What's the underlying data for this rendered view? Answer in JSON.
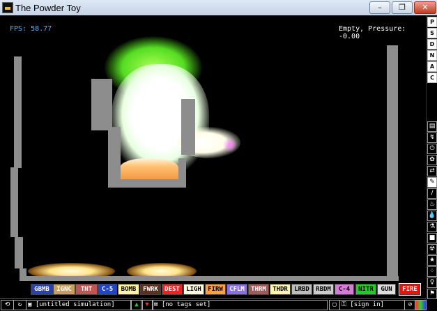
{
  "window": {
    "title": "The Powder Toy",
    "buttons": [
      "–",
      "❐",
      "✕"
    ]
  },
  "hud": {
    "fps": "FPS: 58.77",
    "pressure": "Empty, Pressure: -0.00"
  },
  "menu_buttons": [
    "P",
    "S",
    "D",
    "N",
    "A",
    "C"
  ],
  "tool_icons": [
    "settings-icon",
    "plug-icon",
    "power-icon",
    "gear-icon",
    "arrows-icon",
    "pencil-icon",
    "slash-icon",
    "flame-icon",
    "drop-icon",
    "flask-icon",
    "square-icon",
    "radiation-icon",
    "star-icon",
    "dots-icon",
    "bulb-icon",
    "flag-icon"
  ],
  "tool_glyphs": [
    "▤",
    "↯",
    "⏻",
    "✿",
    "⇄",
    "✎",
    "/",
    "♨",
    "💧",
    "⚗",
    "■",
    "☢",
    "★",
    "⁘",
    "♀",
    "⚑"
  ],
  "elements": [
    {
      "label": "GBMB",
      "bg": "#2b3fae",
      "fg": "#ffffff"
    },
    {
      "label": "IGNC",
      "bg": "#c8a05c",
      "fg": "#ffffff"
    },
    {
      "label": "TNT",
      "bg": "#c05555",
      "fg": "#ffffff"
    },
    {
      "label": "C-5",
      "bg": "#2244cc",
      "fg": "#ffffff"
    },
    {
      "label": "BOMB",
      "bg": "#fff5a0",
      "fg": "#000000"
    },
    {
      "label": "FWRK",
      "bg": "#5a3020",
      "fg": "#ffffff"
    },
    {
      "label": "DEST",
      "bg": "#ee2222",
      "fg": "#ffffff"
    },
    {
      "label": "LIGH",
      "bg": "#fffbe0",
      "fg": "#000000"
    },
    {
      "label": "FIRW",
      "bg": "#ffa040",
      "fg": "#000000"
    },
    {
      "label": "CFLM",
      "bg": "#8a6ee6",
      "fg": "#ffffff"
    },
    {
      "label": "THRM",
      "bg": "#a05a5a",
      "fg": "#ffffff"
    },
    {
      "label": "THDR",
      "bg": "#fff5b0",
      "fg": "#000000"
    },
    {
      "label": "LRBD",
      "bg": "#bcbcbc",
      "fg": "#000000"
    },
    {
      "label": "RBDM",
      "bg": "#cccccc",
      "fg": "#000000"
    },
    {
      "label": "C-4",
      "bg": "#d87ad8",
      "fg": "#000000"
    },
    {
      "label": "NITR",
      "bg": "#22cc22",
      "fg": "#000000"
    },
    {
      "label": "GUN",
      "bg": "#dddddd",
      "fg": "#000000"
    },
    {
      "label": "FIRE",
      "bg": "#ee1100",
      "fg": "#ffffff"
    }
  ],
  "bottom": {
    "save_name": "[untitled simulation]",
    "tags": "[no tags set]",
    "sign_in": "[sign in]"
  }
}
